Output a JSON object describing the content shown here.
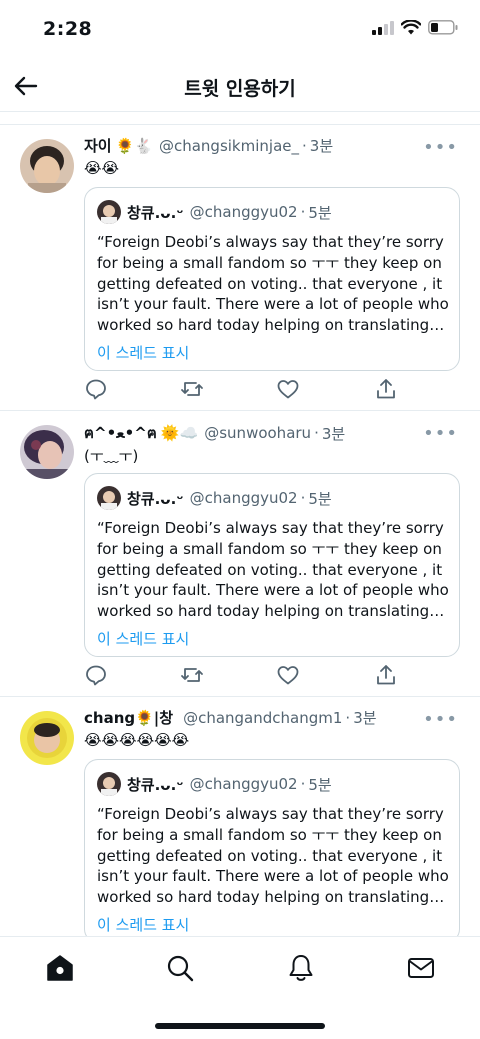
{
  "status_bar": {
    "time": "2:28"
  },
  "header": {
    "title": "트윗 인용하기",
    "back_icon": "arrow-left-icon"
  },
  "tweets": [
    {
      "name": "자이",
      "name_emoji": "🌻🐇",
      "handle": "@changsikminjae_",
      "time": "3분",
      "body": "😭😭",
      "quote": {
        "name": "창큐.ᴗ.ᵕ",
        "handle": "@changgyu02",
        "time": "5분",
        "text": "“Foreign Deobi’s always say that they’re sorry for being a small fandom so ㅜㅜ they keep on getting defeated on voting.. that everyone , it isn’t your fault. There were a lot of people who worked so hard today helping on translating…",
        "link": "이 스레드 표시"
      }
    },
    {
      "name": "ฅ^•ﻌ•^ฅ",
      "name_emoji": "🌞☁️",
      "handle": "@sunwooharu",
      "time": "3분",
      "body": "(ㅜ﹏ㅜ)",
      "quote": {
        "name": "창큐.ᴗ.ᵕ",
        "handle": "@changgyu02",
        "time": "5분",
        "text": "“Foreign Deobi’s always say that they’re sorry for being a small fandom so ㅜㅜ they keep on getting defeated on voting.. that everyone , it isn’t your fault. There were a lot of people who worked so hard today helping on translating…",
        "link": "이 스레드 표시"
      }
    },
    {
      "name": "chang🌻|창",
      "name_emoji": "",
      "handle": "@changandchangm1",
      "time": "3분",
      "body": "😭😭😭😭😭😭",
      "quote": {
        "name": "창큐.ᴗ.ᵕ",
        "handle": "@changgyu02",
        "time": "5분",
        "text": "“Foreign Deobi’s always say that they’re sorry for being a small fandom so ㅜㅜ they keep on getting defeated on voting.. that everyone , it isn’t your fault. There were a lot of people who worked so hard today helping on translating…",
        "link": "이 스레드 표시"
      }
    }
  ],
  "action_icons": [
    "reply-icon",
    "retweet-icon",
    "like-icon",
    "share-icon"
  ],
  "bottom_nav": [
    "home-icon",
    "search-icon",
    "notifications-icon",
    "messages-icon"
  ],
  "colors": {
    "accent": "#1d9bf0",
    "text": "#0f1419",
    "muted": "#536471",
    "border": "#cfd9de"
  }
}
